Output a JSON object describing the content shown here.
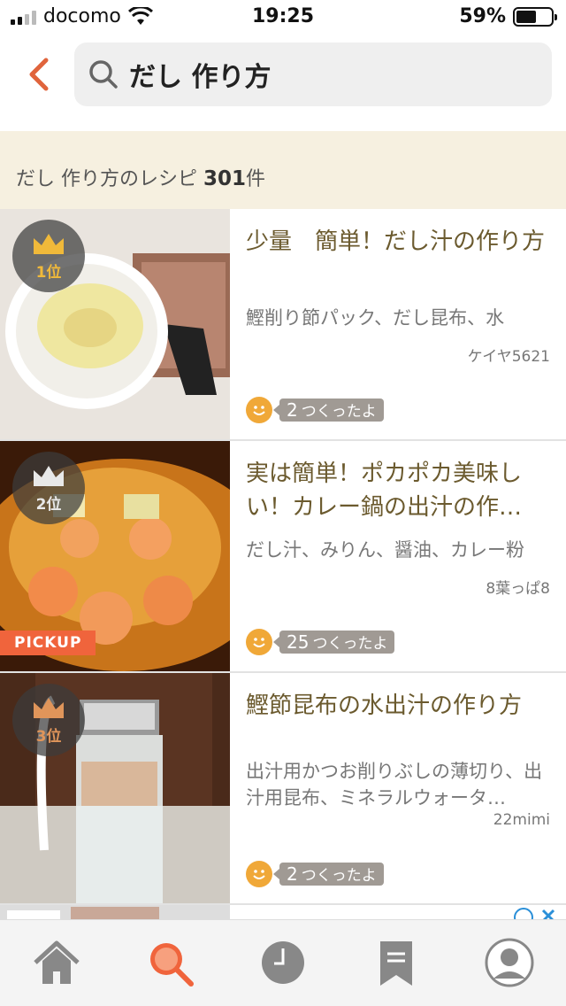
{
  "status_bar": {
    "carrier": "docomo",
    "time": "19:25",
    "battery_percent": "59%",
    "battery_level": 0.59
  },
  "header": {
    "search_query": "だし 作り方",
    "icons": [
      "back-chevron-icon",
      "search-icon"
    ]
  },
  "results": {
    "label_prefix": "だし 作り方のレシピ ",
    "count": "301",
    "label_suffix": "件"
  },
  "recipes": [
    {
      "rank_label": "1位",
      "rank_color": "#f0b93a",
      "title": "少量　簡単！だし汁の作り方",
      "ingredients": "鰹削り節パック、だし昆布、水",
      "author": "ケイヤ5621",
      "tsukurepo_count": "2",
      "tsukurepo_label": "つくったよ",
      "pickup": ""
    },
    {
      "rank_label": "2位",
      "rank_color": "#e8e8e8",
      "title": "実は簡単！ポカポカ美味しい！カレー鍋の出汁の作…",
      "ingredients": "だし汁、みりん、醤油、カレー粉",
      "author": "8葉っぱ8",
      "tsukurepo_count": "25",
      "tsukurepo_label": "つくったよ",
      "pickup": "PICKUP"
    },
    {
      "rank_label": "3位",
      "rank_color": "#e0955a",
      "title": "鰹節昆布の水出汁の作り方",
      "ingredients": "出汁用かつお削りぶしの薄切り、出汁用昆布、ミネラルウォータ…",
      "author": "22mimi",
      "tsukurepo_count": "2",
      "tsukurepo_label": "つくったよ",
      "pickup": ""
    }
  ],
  "tab_bar": {
    "items": [
      "home-icon",
      "search-icon",
      "history-icon",
      "bookmark-icon",
      "account-icon"
    ],
    "active": "search-icon",
    "accent_color": "#f0643c"
  }
}
